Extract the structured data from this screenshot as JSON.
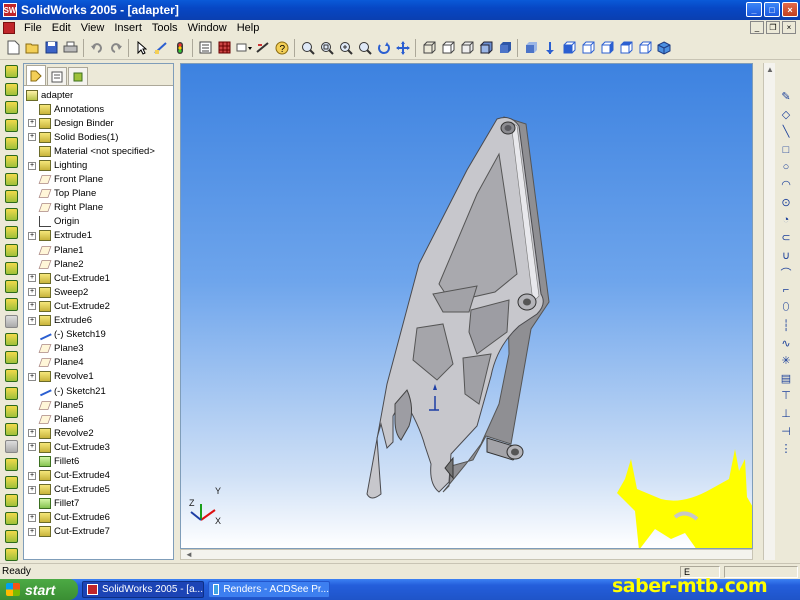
{
  "window": {
    "title": "SolidWorks 2005 - [adapter]",
    "app_icon_text": "SW",
    "controls": {
      "minimize": "_",
      "maximize": "□",
      "close": "×"
    }
  },
  "menubar": {
    "items": [
      "File",
      "Edit",
      "View",
      "Insert",
      "Tools",
      "Window",
      "Help"
    ],
    "mdi_controls": {
      "minimize": "_",
      "restore": "❐",
      "close": "×"
    }
  },
  "toolbar": {
    "groups": [
      [
        "new-icon",
        "open-icon",
        "save-icon",
        "print-icon"
      ],
      [
        "undo-icon",
        "redo-icon"
      ],
      [
        "select-icon",
        "sketch-icon",
        "rebuild-icon"
      ],
      [
        "options-icon",
        "grid-icon",
        "help-icon"
      ],
      [
        "zoom-to-fit-icon",
        "zoom-area-icon",
        "zoom-in-out-icon",
        "zoom-selection-icon",
        "rotate-icon",
        "pan-icon"
      ],
      [
        "wireframe-icon",
        "hidden-lines-visible-icon",
        "hidden-lines-removed-icon",
        "shaded-edges-icon",
        "shaded-icon"
      ],
      [
        "section-view-icon",
        "front-view-icon",
        "back-view-icon",
        "left-view-icon",
        "right-view-icon",
        "top-view-icon",
        "isometric-icon"
      ]
    ]
  },
  "feature_tree": {
    "tabs": [
      "feature-manager-tab",
      "property-manager-tab",
      "configuration-manager-tab"
    ],
    "items": [
      {
        "label": "adapter",
        "icon": "part",
        "expander": "",
        "indent": 0
      },
      {
        "label": "Annotations",
        "icon": "annotations",
        "expander": "",
        "indent": 1
      },
      {
        "label": "Design Binder",
        "icon": "design-binder",
        "expander": "+",
        "indent": 1
      },
      {
        "label": "Solid Bodies(1)",
        "icon": "solid-bodies",
        "expander": "+",
        "indent": 1
      },
      {
        "label": "Material <not specified>",
        "icon": "material",
        "expander": "",
        "indent": 1
      },
      {
        "label": "Lighting",
        "icon": "lighting",
        "expander": "+",
        "indent": 1
      },
      {
        "label": "Front Plane",
        "icon": "plane",
        "expander": "",
        "indent": 1
      },
      {
        "label": "Top Plane",
        "icon": "plane",
        "expander": "",
        "indent": 1
      },
      {
        "label": "Right Plane",
        "icon": "plane",
        "expander": "",
        "indent": 1
      },
      {
        "label": "Origin",
        "icon": "origin",
        "expander": "",
        "indent": 1
      },
      {
        "label": "Extrude1",
        "icon": "feature",
        "expander": "+",
        "indent": 1
      },
      {
        "label": "Plane1",
        "icon": "plane",
        "expander": "",
        "indent": 1
      },
      {
        "label": "Plane2",
        "icon": "plane",
        "expander": "",
        "indent": 1
      },
      {
        "label": "Cut-Extrude1",
        "icon": "feature",
        "expander": "+",
        "indent": 1
      },
      {
        "label": "Sweep2",
        "icon": "feature",
        "expander": "+",
        "indent": 1
      },
      {
        "label": "Cut-Extrude2",
        "icon": "feature",
        "expander": "+",
        "indent": 1
      },
      {
        "label": "Extrude6",
        "icon": "feature",
        "expander": "+",
        "indent": 1
      },
      {
        "label": "(-) Sketch19",
        "icon": "sketch",
        "expander": "",
        "indent": 1
      },
      {
        "label": "Plane3",
        "icon": "plane",
        "expander": "",
        "indent": 1
      },
      {
        "label": "Plane4",
        "icon": "plane",
        "expander": "",
        "indent": 1
      },
      {
        "label": "Revolve1",
        "icon": "feature",
        "expander": "+",
        "indent": 1
      },
      {
        "label": "(-) Sketch21",
        "icon": "sketch",
        "expander": "",
        "indent": 1
      },
      {
        "label": "Plane5",
        "icon": "plane",
        "expander": "",
        "indent": 1
      },
      {
        "label": "Plane6",
        "icon": "plane",
        "expander": "",
        "indent": 1
      },
      {
        "label": "Revolve2",
        "icon": "feature",
        "expander": "+",
        "indent": 1
      },
      {
        "label": "Cut-Extrude3",
        "icon": "feature",
        "expander": "+",
        "indent": 1
      },
      {
        "label": "Fillet6",
        "icon": "fillet",
        "expander": "",
        "indent": 1
      },
      {
        "label": "Cut-Extrude4",
        "icon": "feature",
        "expander": "+",
        "indent": 1
      },
      {
        "label": "Cut-Extrude5",
        "icon": "feature",
        "expander": "+",
        "indent": 1
      },
      {
        "label": "Fillet7",
        "icon": "fillet",
        "expander": "",
        "indent": 1
      },
      {
        "label": "Cut-Extrude6",
        "icon": "feature",
        "expander": "+",
        "indent": 1
      },
      {
        "label": "Cut-Extrude7",
        "icon": "feature",
        "expander": "+",
        "indent": 1
      }
    ]
  },
  "triad": {
    "x": "X",
    "y": "Y",
    "z": "Z"
  },
  "statusbar": {
    "text": "Ready",
    "cell_text": "E"
  },
  "taskbar": {
    "start_label": "start",
    "items": [
      {
        "label": "SolidWorks 2005 - [a...",
        "active": true
      },
      {
        "label": "Renders - ACDSee Pr...",
        "active": false
      }
    ]
  },
  "watermark": "saber-mtb.com",
  "colors": {
    "viewport_top": "#3d82e0",
    "viewport_bottom": "#ffffff",
    "part": "#b8b8b8",
    "watermark": "#ffff00"
  }
}
